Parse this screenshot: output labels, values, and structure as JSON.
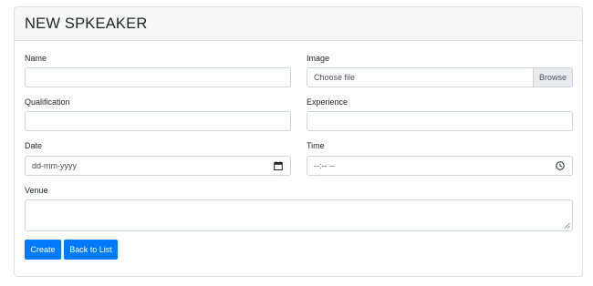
{
  "page": {
    "title": "NEW SPKEAKER"
  },
  "form": {
    "name": {
      "label": "Name",
      "value": ""
    },
    "image": {
      "label": "Image",
      "placeholder": "Choose file",
      "browse_label": "Browse"
    },
    "qualification": {
      "label": "Qualification",
      "value": ""
    },
    "experience": {
      "label": "Experience",
      "value": ""
    },
    "date": {
      "label": "Date",
      "placeholder": "dd-mm-yyyy",
      "icon": "calendar-icon"
    },
    "time": {
      "label": "Time",
      "placeholder": "--:-- --",
      "icon": "clock-icon"
    },
    "venue": {
      "label": "Venue",
      "value": ""
    }
  },
  "actions": {
    "create_label": "Create",
    "back_label": "Back to List"
  },
  "colors": {
    "primary": "#007bff",
    "border": "#ced4da",
    "header_bg": "#f7f7f7"
  }
}
